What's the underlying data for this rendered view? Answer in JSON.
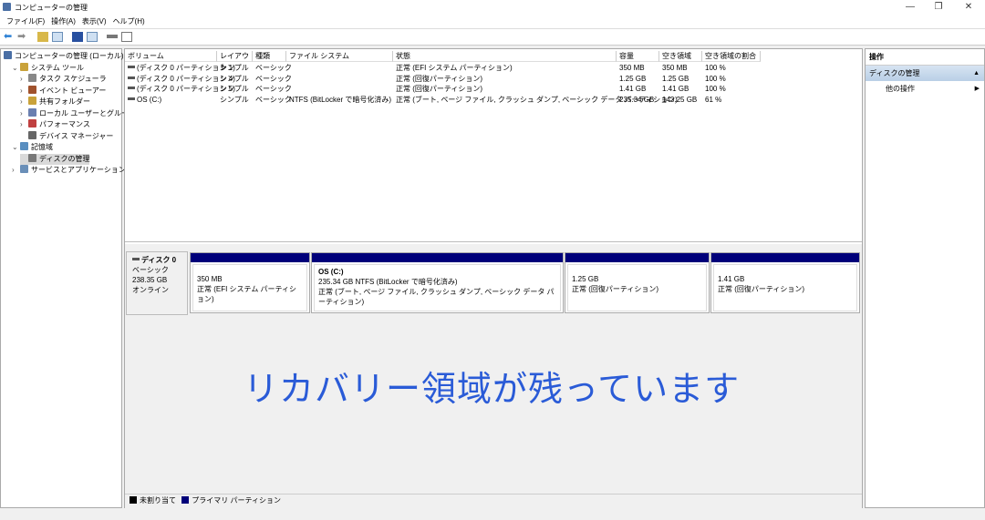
{
  "window": {
    "title": "コンピューターの管理",
    "minimize": "—",
    "restore": "❐",
    "close": "✕"
  },
  "menu": [
    "ファイル(F)",
    "操作(A)",
    "表示(V)",
    "ヘルプ(H)"
  ],
  "toolbar": [
    "back-icon",
    "forward-icon",
    "up-folder-icon",
    "show-hide-tree-icon",
    "help-icon",
    "properties-icon",
    "connect-icon",
    "view-icon"
  ],
  "tree": [
    {
      "label": "コンピューターの管理 (ローカル)",
      "level": 0,
      "expander": ""
    },
    {
      "label": "システム ツール",
      "level": 1,
      "expander": "⌄"
    },
    {
      "label": "タスク スケジューラ",
      "level": 2,
      "expander": "›"
    },
    {
      "label": "イベント ビューアー",
      "level": 2,
      "expander": "›"
    },
    {
      "label": "共有フォルダー",
      "level": 2,
      "expander": "›"
    },
    {
      "label": "ローカル ユーザーとグループ",
      "level": 2,
      "expander": "›"
    },
    {
      "label": "パフォーマンス",
      "level": 2,
      "expander": "›"
    },
    {
      "label": "デバイス マネージャー",
      "level": 2,
      "expander": ""
    },
    {
      "label": "記憶域",
      "level": 1,
      "expander": "⌄"
    },
    {
      "label": "ディスクの管理",
      "level": 2,
      "expander": "",
      "selected": true
    },
    {
      "label": "サービスとアプリケーション",
      "level": 1,
      "expander": "›"
    }
  ],
  "volumes": {
    "columns": [
      "ボリューム",
      "レイアウト",
      "種類",
      "ファイル システム",
      "状態",
      "容量",
      "空き領域",
      "空き領域の割合"
    ],
    "rows": [
      [
        "(ディスク 0 パーティション 1)",
        "シンプル",
        "ベーシック",
        "",
        "正常 (EFI システム パーティション)",
        "350 MB",
        "350 MB",
        "100 %"
      ],
      [
        "(ディスク 0 パーティション 4)",
        "シンプル",
        "ベーシック",
        "",
        "正常 (回復パーティション)",
        "1.25 GB",
        "1.25 GB",
        "100 %"
      ],
      [
        "(ディスク 0 パーティション 5)",
        "シンプル",
        "ベーシック",
        "",
        "正常 (回復パーティション)",
        "1.41 GB",
        "1.41 GB",
        "100 %"
      ],
      [
        "OS (C:)",
        "シンプル",
        "ベーシック",
        "NTFS (BitLocker で暗号化済み)",
        "正常 (ブート, ページ ファイル, クラッシュ ダンプ, ベーシック データ パーティション)",
        "235.34 GB",
        "143.25 GB",
        "61 %"
      ]
    ]
  },
  "disk": {
    "name": "ディスク 0",
    "type": "ベーシック",
    "size": "238.35 GB",
    "status": "オンライン",
    "partitions": [
      {
        "title": "",
        "line1": "350 MB",
        "line2": "正常 (EFI システム パーティション)"
      },
      {
        "title": "OS  (C:)",
        "line1": "235.34 GB NTFS (BitLocker で暗号化済み)",
        "line2": "正常 (ブート, ページ ファイル, クラッシュ ダンプ, ベーシック データ パーティション)"
      },
      {
        "title": "",
        "line1": "1.25 GB",
        "line2": "正常 (回復パーティション)"
      },
      {
        "title": "",
        "line1": "1.41 GB",
        "line2": "正常 (回復パーティション)"
      }
    ]
  },
  "overlay_text": "リカバリー領域が残っています",
  "legend": [
    {
      "label": "未割り当て",
      "color": "#000000"
    },
    {
      "label": "プライマリ パーティション",
      "color": "#00007a"
    }
  ],
  "actions": {
    "header": "操作",
    "section": "ディスクの管理",
    "item": "他の操作"
  }
}
